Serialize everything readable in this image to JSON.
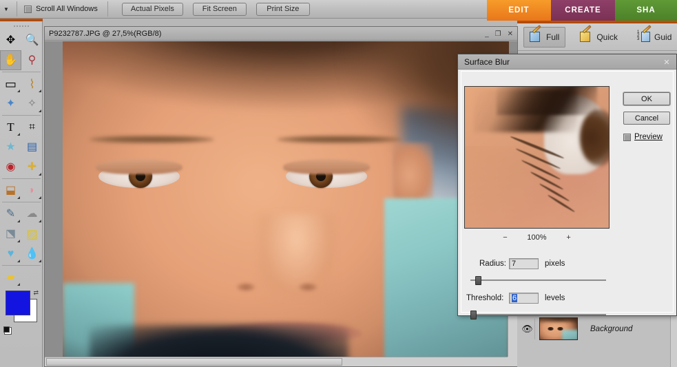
{
  "options_bar": {
    "dropdown_arrow": "▼",
    "scroll_all_windows_label": "Scroll All Windows",
    "buttons": [
      {
        "label": "Actual Pixels"
      },
      {
        "label": "Fit Screen"
      },
      {
        "label": "Print Size"
      }
    ]
  },
  "mode_tabs": [
    {
      "label": "EDIT",
      "color": "#ef8a22",
      "active": true
    },
    {
      "label": "CREATE",
      "color": "#8e4068",
      "active": false
    },
    {
      "label": "SHA",
      "color": "#5f9a36",
      "active": false
    }
  ],
  "edit_modes": [
    {
      "label": "Full",
      "icon": "pencil-photo-icon",
      "active": true
    },
    {
      "label": "Quick",
      "icon": "pencil-quick-icon",
      "active": false
    },
    {
      "label": "Guid",
      "icon": "pencil-guided-icon",
      "active": false
    }
  ],
  "toolbox": {
    "tools": [
      {
        "name": "move-tool",
        "glyph": "✥",
        "selected": false,
        "has_flyout": false
      },
      {
        "name": "zoom-tool",
        "glyph": "🔍",
        "selected": false,
        "has_flyout": false
      },
      {
        "name": "hand-tool",
        "glyph": "✋",
        "selected": true,
        "has_flyout": false
      },
      {
        "name": "eyedropper-tool",
        "glyph": "⚲",
        "selected": false,
        "has_flyout": false
      },
      {
        "name": "rectangular-marquee-tool",
        "glyph": "▭",
        "selected": false,
        "has_flyout": true
      },
      {
        "name": "lasso-tool",
        "glyph": "⌇",
        "selected": false,
        "has_flyout": true
      },
      {
        "name": "magic-wand-tool",
        "glyph": "✦",
        "selected": false,
        "has_flyout": false
      },
      {
        "name": "selection-brush-tool",
        "glyph": "✧",
        "selected": false,
        "has_flyout": true
      },
      {
        "name": "type-tool",
        "glyph": "T",
        "selected": false,
        "has_flyout": true
      },
      {
        "name": "crop-tool",
        "glyph": "⌗",
        "selected": false,
        "has_flyout": false
      },
      {
        "name": "cookie-cutter-tool",
        "glyph": "★",
        "selected": false,
        "has_flyout": false
      },
      {
        "name": "straighten-tool",
        "glyph": "▤",
        "selected": false,
        "has_flyout": false
      },
      {
        "name": "red-eye-removal-tool",
        "glyph": "◉",
        "selected": false,
        "has_flyout": false
      },
      {
        "name": "healing-brush-tool",
        "glyph": "✚",
        "selected": false,
        "has_flyout": true
      },
      {
        "name": "clone-stamp-tool",
        "glyph": "⬓",
        "selected": false,
        "has_flyout": true
      },
      {
        "name": "eraser-tool",
        "glyph": "◗",
        "selected": false,
        "has_flyout": true
      },
      {
        "name": "brush-tool",
        "glyph": "✎",
        "selected": false,
        "has_flyout": true
      },
      {
        "name": "smudge-tool",
        "glyph": "☁",
        "selected": false,
        "has_flyout": true
      },
      {
        "name": "paint-bucket-tool",
        "glyph": "⬔",
        "selected": false,
        "has_flyout": true
      },
      {
        "name": "gradient-tool",
        "glyph": "▨",
        "selected": false,
        "has_flyout": true
      },
      {
        "name": "shape-tool",
        "glyph": "♥",
        "selected": false,
        "has_flyout": true
      },
      {
        "name": "blur-tool",
        "glyph": "💧",
        "selected": false,
        "has_flyout": true
      },
      {
        "name": "sponge-tool",
        "glyph": "▰",
        "selected": false,
        "has_flyout": true
      }
    ],
    "color_swatch": {
      "foreground": "#1414e0",
      "background": "#ffffff",
      "swap_icon": "swap-colors-icon",
      "default_icon": "default-colors-icon"
    }
  },
  "document_window": {
    "title": "P9232787.JPG @ 27,5%(RGB/8)",
    "minimize_icon": "_",
    "maximize_icon": "❐",
    "close_icon": "✕"
  },
  "dialog": {
    "title": "Surface Blur",
    "close_icon": "✕",
    "zoom": {
      "minus_label": "−",
      "level": "100%",
      "plus_label": "+"
    },
    "radius": {
      "label": "Radius:",
      "value": "7",
      "unit": "pixels",
      "slider_percent": 5
    },
    "threshold": {
      "label": "Threshold:",
      "value": "6",
      "unit": "levels",
      "selected": true,
      "slider_percent": 1
    },
    "ok_label": "OK",
    "cancel_label": "Cancel",
    "preview_label": "Preview",
    "preview_checked": false
  },
  "layers_panel": {
    "rows": [
      {
        "visibility_icon": "eye-icon",
        "name": "Background",
        "thumbnail": "layer-thumbnail"
      }
    ]
  }
}
